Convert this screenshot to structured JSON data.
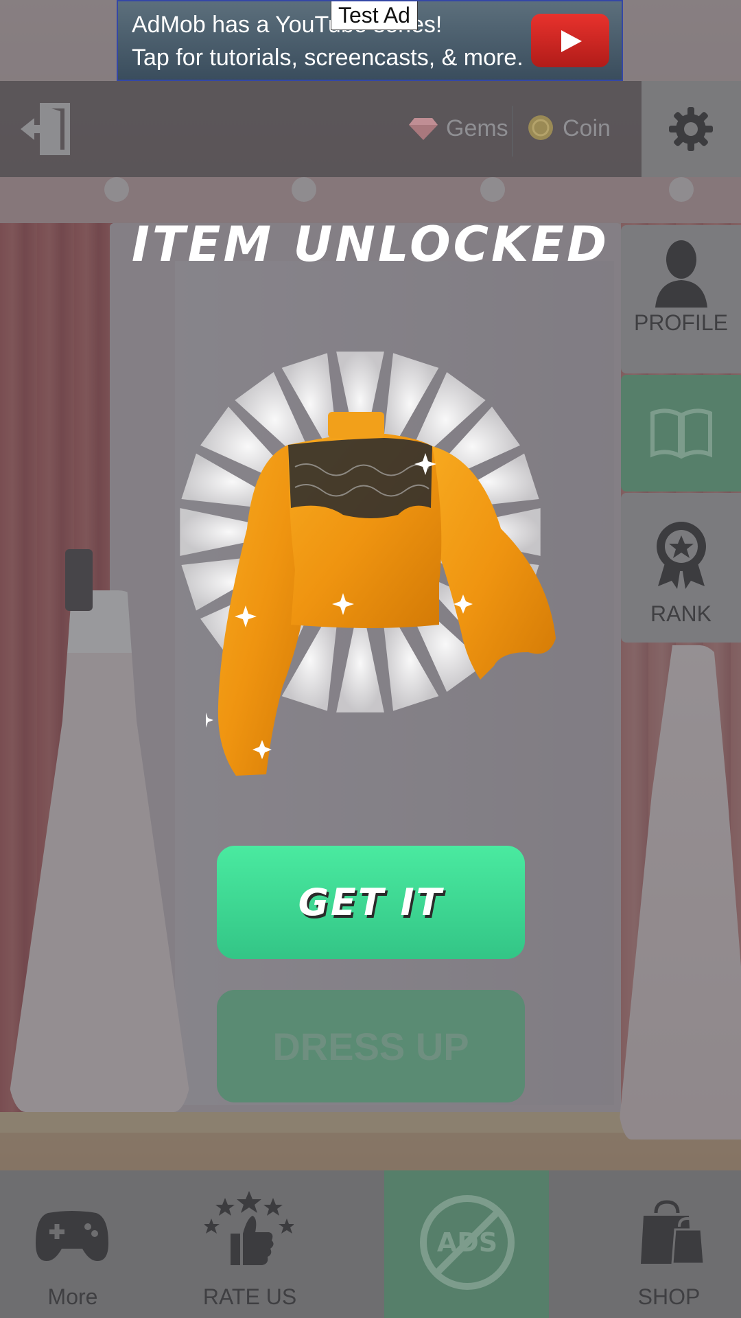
{
  "ad": {
    "headline": "AdMob has a YouTube series!",
    "subline": "Tap for tutorials, screencasts, & more.",
    "badge": "Test Ad"
  },
  "header": {
    "gems_label": "Gems",
    "coin_label": "Coin"
  },
  "side_menu": {
    "profile_label": "PROFILE",
    "rank_label": "RANK"
  },
  "dialog": {
    "title": "ITEM UNLOCKED",
    "get_it_label": "GET IT",
    "dress_up_label": "DRESS UP"
  },
  "bottom_nav": {
    "more_label": "More",
    "rate_label": "RATE US",
    "ads_label": "ADS",
    "shop_label": "SHOP"
  },
  "colors": {
    "accent_green": "#3fdb97",
    "blouse_orange": "#f29a12"
  }
}
